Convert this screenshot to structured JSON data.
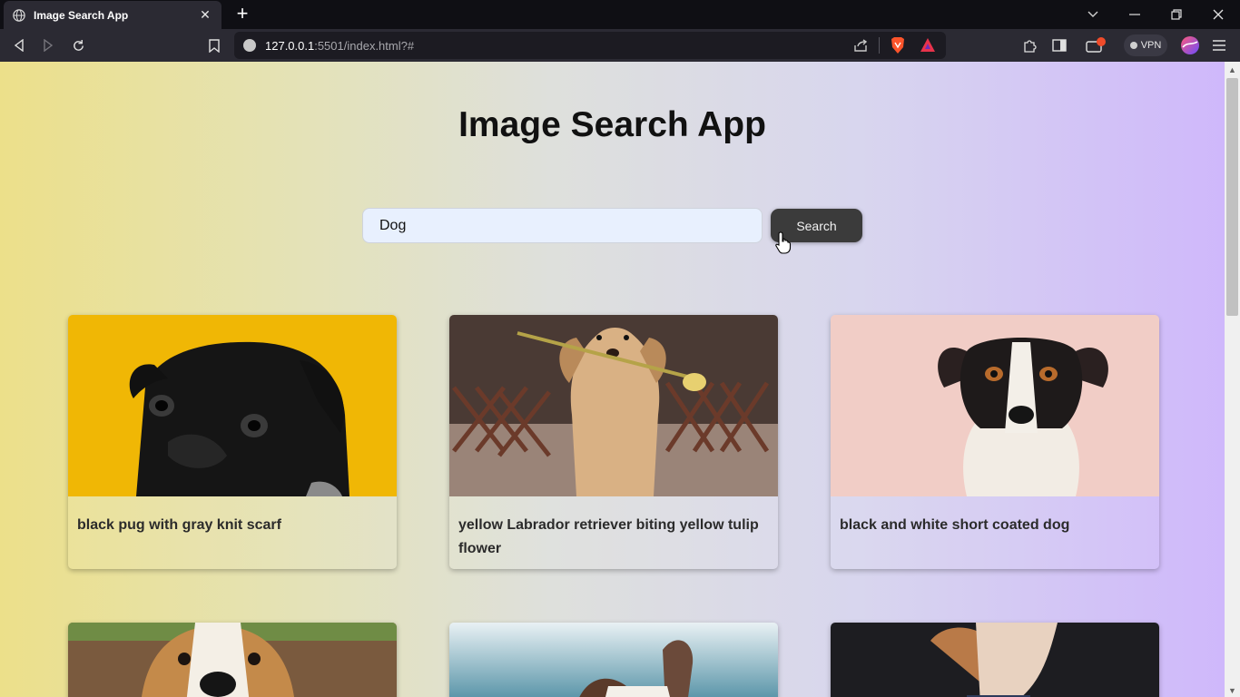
{
  "browser": {
    "tab_title": "Image Search App",
    "new_tab_symbol": "+",
    "url_host": "127.0.0.1",
    "url_path": ":5501/index.html?#",
    "vpn_label": "VPN"
  },
  "page": {
    "title": "Image Search App",
    "search": {
      "value": "Dog",
      "button_label": "Search"
    },
    "results": [
      {
        "caption": "black pug with gray knit scarf",
        "photo": "black pug on yellow background"
      },
      {
        "caption": "yellow Labrador retriever biting yellow tulip flower",
        "photo": "golden dog holding tulip"
      },
      {
        "caption": "black and white short coated dog",
        "photo": "jack russell on pink background"
      },
      {
        "caption": "",
        "photo": "beagle close-up"
      },
      {
        "caption": "",
        "photo": "dog by the sea"
      },
      {
        "caption": "",
        "photo": "dog on dark background"
      }
    ]
  },
  "colors": {
    "gradient_left": "#ece08a",
    "gradient_right": "#cfb8fb",
    "button_bg": "#3b3b3b",
    "input_bg": "#e8f0fe"
  },
  "icons": [
    "globe-icon",
    "close-icon",
    "plus-icon",
    "back-icon",
    "forward-icon",
    "reload-icon",
    "bookmark-icon",
    "info-icon",
    "share-icon",
    "brave-lion-icon",
    "brave-rewards-icon",
    "extensions-icon",
    "sidebar-icon",
    "wallet-icon",
    "profile-icon",
    "menu-icon",
    "chevron-down-icon",
    "minimize-icon",
    "restore-icon",
    "window-close-icon",
    "pointer-cursor-icon"
  ]
}
